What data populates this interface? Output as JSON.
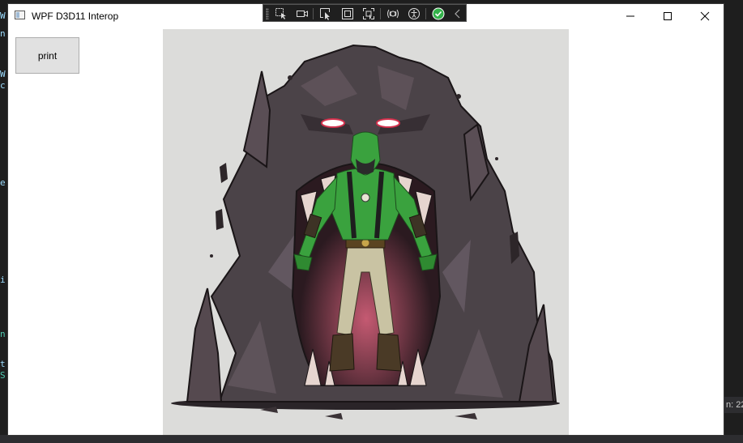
{
  "window": {
    "title": "WPF D3D11 Interop"
  },
  "caption_buttons": [
    "minimize-icon",
    "maximize-icon",
    "close-icon"
  ],
  "debug_toolbar": {
    "icons": [
      "select-element-icon",
      "video-record-icon",
      "pointer-select-icon",
      "display-layout-adorners-icon",
      "track-focus-icon",
      "hot-reload-icon",
      "accessibility-icon",
      "checkmark-circle-icon",
      "chevron-left-icon"
    ],
    "accent_check": "#33b24a"
  },
  "toolbar": {
    "print_label": "print"
  },
  "background_editor": {
    "right_status_text": "n: 22"
  },
  "colors": {
    "window_bg": "#ffffff",
    "render_bg": "#dcdcda",
    "button_bg": "#e1e1e1",
    "editor_bg": "#1e1e1e"
  }
}
